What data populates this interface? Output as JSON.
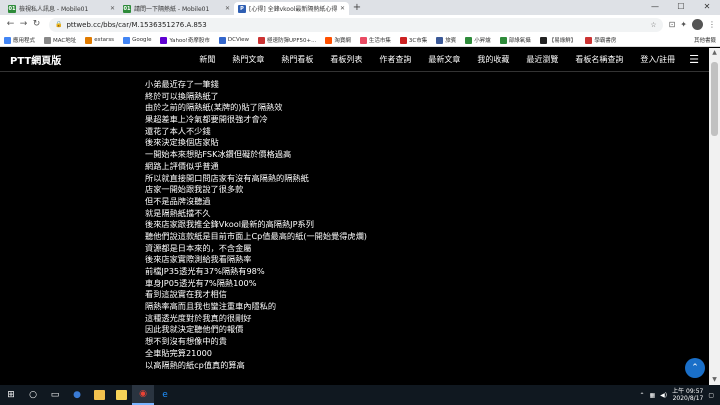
{
  "browser": {
    "tabs": [
      {
        "label": "檢視私人訊息 - Mobile01",
        "favicon_color": "#2e8b3a",
        "favicon_text": "01",
        "active": false
      },
      {
        "label": "請問一下隔熱紙 - Mobile01",
        "favicon_color": "#2e8b3a",
        "favicon_text": "01",
        "active": false
      },
      {
        "label": "[心得] 全鋒vkool最新隔熱紙心得",
        "favicon_color": "#2f5fb3",
        "favicon_text": "P",
        "active": true
      }
    ],
    "new_tab_glyph": "+",
    "window_controls": [
      "—",
      "☐",
      "✕"
    ],
    "url": "pttweb.cc/bbs/car/M.1536351276.A.853",
    "bookmarks": [
      {
        "label": "應用程式",
        "color": "#4285f4"
      },
      {
        "label": "MAC地址",
        "color": "#888888"
      },
      {
        "label": "estarss",
        "color": "#e07b00"
      },
      {
        "label": "Google",
        "color": "#4285f4"
      },
      {
        "label": "Yahoo!奇摩股市",
        "color": "#6001d2"
      },
      {
        "label": "DCView",
        "color": "#3366cc"
      },
      {
        "label": "極速防彈UPF50+...",
        "color": "#cc3333"
      },
      {
        "label": "淘寶網",
        "color": "#ff5000"
      },
      {
        "label": "生活市集",
        "color": "#e94b63"
      },
      {
        "label": "3C市集",
        "color": "#cc2222"
      },
      {
        "label": "旅賓",
        "color": "#3b5998"
      },
      {
        "label": "小昇爐",
        "color": "#2e8b3a"
      },
      {
        "label": "部綠氧攝",
        "color": "#2e8b3a"
      },
      {
        "label": "【易綠鮮】",
        "color": "#222222"
      },
      {
        "label": "學霸書房",
        "color": "#cc3333"
      }
    ],
    "bookmarks_other": "其他書籤"
  },
  "ptt": {
    "brand": "PTT網頁版",
    "nav": [
      "新聞",
      "熱門文章",
      "熱門看板",
      "看板列表",
      "作者查詢",
      "最新文章",
      "我的收藏",
      "最近瀏覽",
      "看板名稱查詢",
      "登入/註冊"
    ],
    "menu_glyph": "☰",
    "top_glyph": "⌃"
  },
  "article": {
    "lines": [
      "小弟最近存了一筆錢",
      "終於可以換隔熱紙了",
      "由於之前的隔熱紙(某牌的)貼了隔熱效",
      "果超差車上冷氣都要開很強才會冷",
      "還花了本人不少錢",
      "後來決定換個店家貼",
      "一開始本來想貼FSK冰鑽但礙於價格過高",
      "網路上評價似乎普通",
      "所以就直接開口問店家有沒有高隔熱的隔熱紙",
      "店家一開始跟我說了很多款",
      "但不是品牌沒聽過",
      "就是隔熱紙擋不久",
      "後來店家跟我推全鋒Vkool最新的高隔熱JP系列",
      "聽他們說這款紙是目前市面上Cp值最高的紙(一開始覺得虎爛)",
      "資源都是日本來的，不含金屬",
      "後來店家實際測給我看隔熱率",
      "前檔JP35透光有37%隔熱有98%",
      "車身JP05透光有7%隔熱100%",
      "看到這說實在我才相信",
      "隔熱率高而且我也蠻注重車內隱私的",
      "這種透光度對於我真的很剛好",
      "因此我就決定聽他們的報價",
      "想不到沒有想像中的貴",
      "全車貼完算21000",
      "以高隔熱的紙cp值真的算高"
    ]
  },
  "taskbar": {
    "apps": [
      {
        "name": "start",
        "glyph": "⊞",
        "color": "#ffffff"
      },
      {
        "name": "search",
        "glyph": "○",
        "color": "#ffffff"
      },
      {
        "name": "taskview",
        "glyph": "▭",
        "color": "#ffffff"
      },
      {
        "name": "media",
        "glyph": "●",
        "color": "#3a7bd5"
      },
      {
        "name": "explorer",
        "glyph": "",
        "color": "#f2c14e"
      },
      {
        "name": "notes",
        "glyph": "",
        "color": "#f7d358"
      },
      {
        "name": "chrome",
        "glyph": "◉",
        "color": "#ea4335"
      },
      {
        "name": "ie",
        "glyph": "e",
        "color": "#1e90ff"
      }
    ],
    "time": "上午 09:57",
    "date": "2020/8/17"
  }
}
